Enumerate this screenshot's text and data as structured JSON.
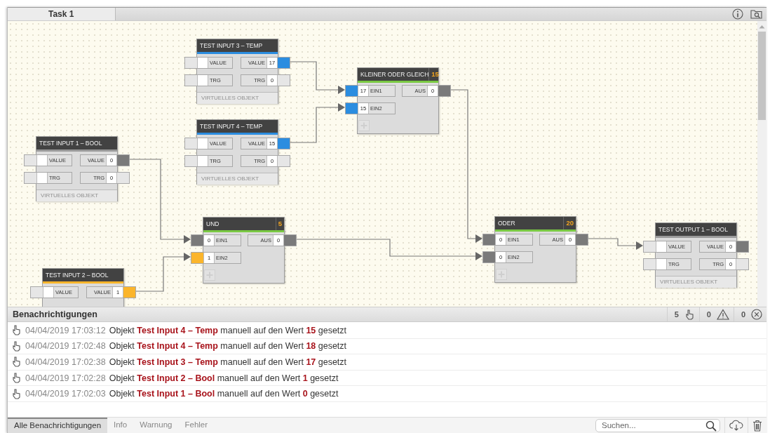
{
  "tabs": [
    {
      "label": "Task 1",
      "selected": true
    }
  ],
  "nodes": [
    {
      "kind": "object",
      "title": "TEST INPUT 3 – TEMP",
      "color": "#2b8de0",
      "inputs": [
        {
          "label": "VALUE",
          "color": "#e6e6e6"
        },
        {
          "label": "TRG",
          "color": "#e6e6e6"
        }
      ],
      "outputs": [
        {
          "label": "VALUE",
          "value": "17",
          "color": "#2b8de0"
        },
        {
          "label": "TRG",
          "value": "0",
          "color": "#e6e6e6"
        }
      ],
      "footer": "VIRTUELLES OBJEKT"
    },
    {
      "kind": "logic",
      "title": "KLEINER ODER GLEICH",
      "badge": "15",
      "color": "#7ac943",
      "inputs": [
        {
          "label": "EIN1",
          "value": "17",
          "color": "#2b8de0"
        },
        {
          "label": "EIN2",
          "value": "15",
          "color": "#2b8de0"
        }
      ],
      "outputs": [
        {
          "label": "AUS",
          "value": "0",
          "color": "#7a7a7a"
        }
      ]
    },
    {
      "kind": "object",
      "title": "TEST INPUT 4 – TEMP",
      "color": "#2b8de0",
      "inputs": [
        {
          "label": "VALUE",
          "color": "#e6e6e6"
        },
        {
          "label": "TRG",
          "color": "#e6e6e6"
        }
      ],
      "outputs": [
        {
          "label": "VALUE",
          "value": "15",
          "color": "#2b8de0"
        },
        {
          "label": "TRG",
          "value": "0",
          "color": "#e6e6e6"
        }
      ],
      "footer": "VIRTUELLES OBJEKT"
    },
    {
      "kind": "object",
      "title": "TEST INPUT 1 – BOOL",
      "color": "#9a9a9a",
      "inputs": [
        {
          "label": "VALUE",
          "color": "#e6e6e6"
        },
        {
          "label": "TRG",
          "color": "#e6e6e6"
        }
      ],
      "outputs": [
        {
          "label": "VALUE",
          "value": "0",
          "color": "#7a7a7a"
        },
        {
          "label": "TRG",
          "value": "0",
          "color": "#e6e6e6"
        }
      ],
      "footer": "VIRTUELLES OBJEKT"
    },
    {
      "kind": "logic",
      "title": "UND",
      "badge": "5",
      "color": "#7ac943",
      "inputs": [
        {
          "label": "EIN1",
          "value": "0",
          "color": "#7a7a7a"
        },
        {
          "label": "EIN2",
          "value": "1",
          "color": "#fbb52b"
        }
      ],
      "outputs": [
        {
          "label": "AUS",
          "value": "0",
          "color": "#7a7a7a"
        }
      ]
    },
    {
      "kind": "logic",
      "title": "ODER",
      "badge": "20",
      "color": "#7ac943",
      "inputs": [
        {
          "label": "EIN1",
          "value": "0",
          "color": "#7a7a7a"
        },
        {
          "label": "EIN2",
          "value": "0",
          "color": "#7a7a7a"
        }
      ],
      "outputs": [
        {
          "label": "AUS",
          "value": "0",
          "color": "#7a7a7a"
        }
      ]
    },
    {
      "kind": "object",
      "title": "TEST OUTPUT 1 – BOOL",
      "color": "#9a9a9a",
      "inputs": [
        {
          "label": "VALUE",
          "color": "#e6e6e6"
        },
        {
          "label": "TRG",
          "color": "#e6e6e6"
        }
      ],
      "outputs": [
        {
          "label": "VALUE",
          "value": "0",
          "color": "#7a7a7a"
        },
        {
          "label": "TRG",
          "value": "0",
          "color": "#e6e6e6"
        }
      ],
      "footer": "VIRTUELLES OBJEKT"
    },
    {
      "kind": "object",
      "title": "TEST INPUT 2 – BOOL",
      "color": "#fbb52b",
      "inputs": [
        {
          "label": "VALUE",
          "color": "#e6e6e6"
        }
      ],
      "outputs": [
        {
          "label": "VALUE",
          "value": "1",
          "color": "#fbb52b"
        }
      ]
    }
  ],
  "notifications": {
    "title": "Benachrichtigungen",
    "counters": [
      {
        "kind": "manual",
        "count": "5"
      },
      {
        "kind": "warning",
        "count": "0"
      },
      {
        "kind": "error",
        "count": "0"
      }
    ],
    "items": [
      {
        "kind": "manual",
        "time": "04/04/2019 17:03:12",
        "text": "Objekt **Test Input 4 – Temp** manuell auf den Wert **15** gesetzt"
      },
      {
        "kind": "manual",
        "time": "04/04/2019 17:02:48",
        "text": "Objekt **Test Input 4 – Temp** manuell auf den Wert **18** gesetzt"
      },
      {
        "kind": "manual",
        "time": "04/04/2019 17:02:38",
        "text": "Objekt **Test Input 3 – Temp** manuell auf den Wert **17** gesetzt"
      },
      {
        "kind": "manual",
        "time": "04/04/2019 17:02:28",
        "text": "Objekt **Test Input 2 – Bool** manuell auf den Wert **1** gesetzt"
      },
      {
        "kind": "manual",
        "time": "04/04/2019 17:02:03",
        "text": "Objekt **Test Input 1 – Bool** manuell auf den Wert **0** gesetzt"
      }
    ],
    "filters": [
      {
        "label": "Alle Benachrichtigungen",
        "selected": true
      },
      {
        "label": "Info",
        "selected": false
      },
      {
        "label": "Warnung",
        "selected": false
      },
      {
        "label": "Fehler",
        "selected": false
      }
    ],
    "search": {
      "placeholder": "Suchen..."
    }
  }
}
